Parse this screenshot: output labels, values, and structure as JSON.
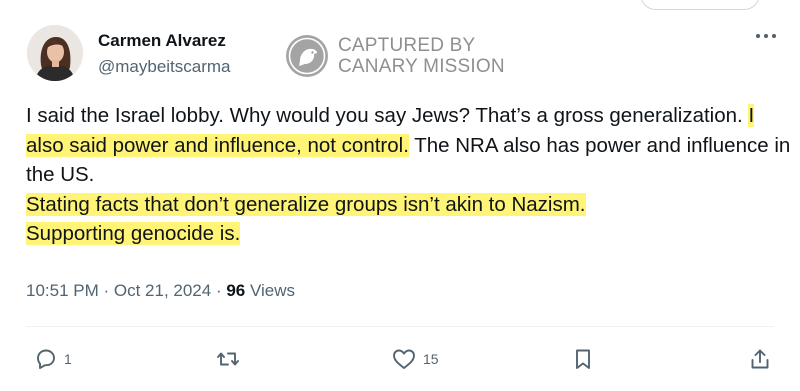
{
  "author": {
    "name": "Carmen Alvarez",
    "handle": "@maybeitscarma"
  },
  "watermark": {
    "line1": "CAPTURED BY",
    "line2": "CANARY MISSION"
  },
  "more_icon": "more-dots-icon",
  "body": {
    "seg1": "I said the Israel lobby. Why would you say Jews? That’s a gross generalization. ",
    "seg2_highlight": "I also said power and influence, not control.",
    "seg3": " The NRA also has power and influence in the US.",
    "seg4_highlight": "Stating facts that don’t generalize groups isn’t akin to Nazism.",
    "seg5_highlight": "Supporting genocide is."
  },
  "meta": {
    "time": "10:51 PM",
    "sep1": " · ",
    "date": "Oct 21, 2024",
    "sep2": " · ",
    "views_count": "96",
    "views_label": " Views"
  },
  "actions": {
    "replies": "1",
    "reposts": "",
    "likes": "15"
  },
  "colors": {
    "highlight": "#fff475",
    "text": "#0f1419",
    "muted": "#536471"
  }
}
